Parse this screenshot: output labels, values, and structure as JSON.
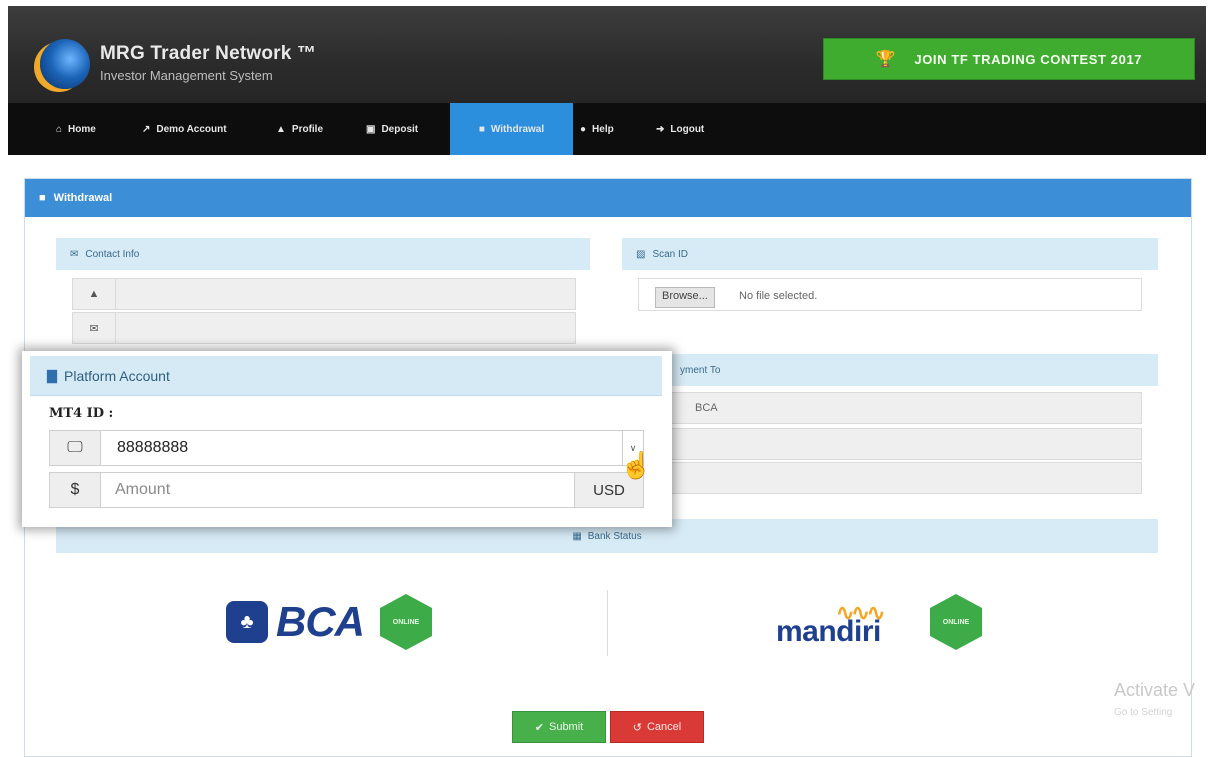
{
  "header": {
    "brand_title": "MRG Trader Network ™",
    "brand_subtitle": "Investor Management System",
    "contest_button": "JOIN TF TRADING CONTEST 2017"
  },
  "nav": [
    {
      "label": "Home",
      "icon": "home-icon",
      "active": false
    },
    {
      "label": "Demo Account",
      "icon": "chart-icon",
      "active": false
    },
    {
      "label": "Profile",
      "icon": "user-icon",
      "active": false
    },
    {
      "label": "Deposit",
      "icon": "money-icon",
      "active": false
    },
    {
      "label": "Withdrawal",
      "icon": "wallet-icon",
      "active": true
    },
    {
      "label": "Help",
      "icon": "question-icon",
      "active": false
    },
    {
      "label": "Logout",
      "icon": "logout-icon",
      "active": false
    }
  ],
  "panel": {
    "title": "Withdrawal",
    "contact_info": "Contact Info",
    "scan_id": "Scan ID",
    "browse": "Browse...",
    "no_file": "No file selected.",
    "payment_to": "yment To",
    "bank_name": "BCA",
    "bank_status": "Bank Status"
  },
  "banks": {
    "bca": "BCA",
    "bca_status": "ONLINE",
    "mandiri": "mandiri",
    "mandiri_status": "ONLINE"
  },
  "buttons": {
    "submit": "Submit",
    "cancel": "Cancel"
  },
  "popup": {
    "title": "Platform Account",
    "mt4_label": "MT4 ID :",
    "mt4_value": "88888888",
    "amount_placeholder": "Amount",
    "currency": "USD"
  },
  "watermark": {
    "line1": "Activate V",
    "line2": "Go to Setting"
  },
  "colors": {
    "accent": "#3c8fd6",
    "contest": "#3fab2f",
    "submit": "#48b04a",
    "cancel": "#da3a35"
  }
}
